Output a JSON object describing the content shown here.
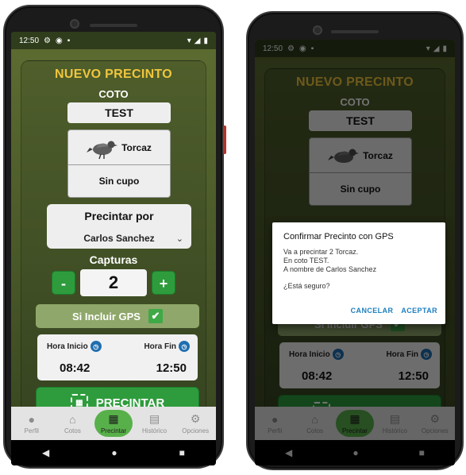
{
  "status": {
    "time": "12:50"
  },
  "screen": {
    "title": "NUEVO PRECINTO",
    "coto_label": "COTO",
    "coto_value": "TEST",
    "species_name": "Torcaz",
    "quota_text": "Sin cupo",
    "precintar_por_label": "Precintar por",
    "hunter_name": "Carlos Sanchez",
    "capturas_label": "Capturas",
    "minus_label": "-",
    "plus_label": "+",
    "capturas_value": "2",
    "gps_label": "Si Incluir GPS",
    "gps_checked": true,
    "hora_inicio_label": "Hora Inicio",
    "hora_inicio_value": "08:42",
    "hora_fin_label": "Hora Fin",
    "hora_fin_value": "12:50",
    "precintar_button": "PRECINTAR"
  },
  "nav": {
    "items": [
      {
        "label": "Perfil",
        "icon": "person-icon"
      },
      {
        "label": "Cotos",
        "icon": "home-icon"
      },
      {
        "label": "Precintar",
        "icon": "qr-icon"
      },
      {
        "label": "Histórico",
        "icon": "calendar-icon"
      },
      {
        "label": "Opciones",
        "icon": "gear-icon"
      }
    ],
    "active": "Precintar"
  },
  "dialog": {
    "title": "Confirmar Precinto con GPS",
    "line1": "Va a precintar 2 Torcaz.",
    "line2": "En coto TEST.",
    "line3": "A nombre de Carlos Sanchez",
    "question": "¿Está seguro?",
    "cancel": "CANCELAR",
    "accept": "ACEPTAR"
  },
  "colors": {
    "accent_green": "#2e9c3c",
    "title_yellow": "#f0c63d",
    "dialog_action": "#1c7fc0"
  }
}
